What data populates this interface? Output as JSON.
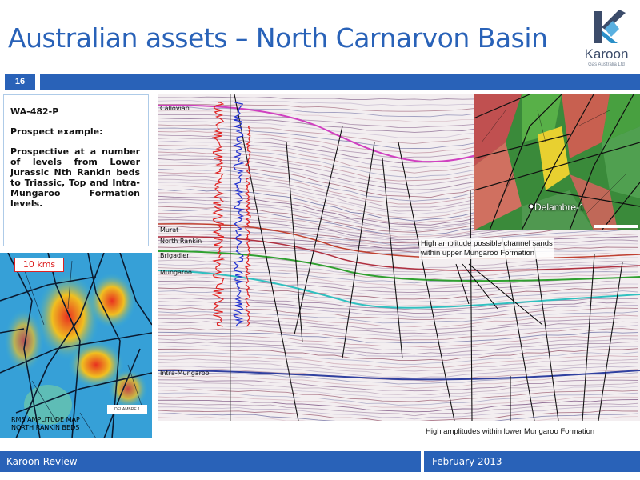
{
  "slide": {
    "title": "Australian assets – North Carnarvon Basin",
    "page_number": "16"
  },
  "logo": {
    "name": "Karoon",
    "subtitle": "Gas Australia Ltd"
  },
  "text_panel": {
    "block_name": "WA-482-P",
    "heading": "Prospect example:",
    "body": "Prospective at a number of levels from Lower Jurassic Nth Rankin beds to Triassic, Top and Intra-Mungaroo Formation levels."
  },
  "amplitude_map": {
    "scale_label": "10 kms",
    "caption_line1": "RMS AMPLITUDE MAP",
    "caption_line2": "NORTH RANKIN BEDS",
    "well_tag": "DELAMBRE 1"
  },
  "seismic": {
    "horizons": [
      "Callovian",
      "Murat",
      "North Rankin",
      "Brigadier",
      "Mungaroo",
      "Intra-Mungaroo"
    ],
    "annotation_upper_line1": "High amplitude possible channel sands",
    "annotation_upper_line2": "within upper Mungaroo Formation",
    "annotation_lower": "High amplitudes within lower Mungaroo Formation"
  },
  "inset_map": {
    "well_label": "Delambre-1"
  },
  "footer": {
    "left": "Karoon Review",
    "right": "February 2013"
  },
  "colors": {
    "brand_blue": "#2962b8",
    "callovian": "#d040c0",
    "murat": "#c04030",
    "north_rankin": "#b03040",
    "brigadier": "#30a030",
    "mungaroo": "#30c0c0",
    "intra_mungaroo": "#3040a0"
  }
}
